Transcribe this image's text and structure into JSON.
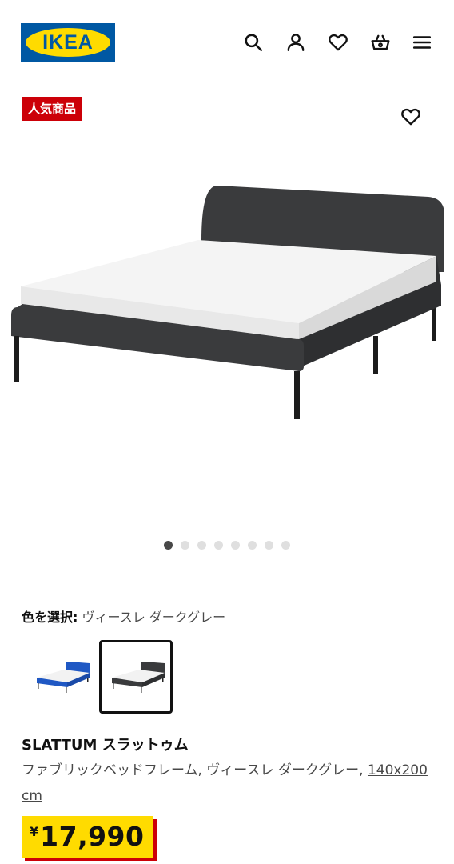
{
  "header": {
    "logo_text": "IKEA",
    "icons": [
      "search-icon",
      "user-icon",
      "heart-icon",
      "cart-icon",
      "menu-icon"
    ]
  },
  "badge": {
    "label": "人気商品"
  },
  "carousel": {
    "total": 8,
    "active": 1
  },
  "color_select": {
    "label": "色を選択:",
    "value": "ヴィースレ ダークグレー",
    "options": [
      {
        "color": "#1f58c4",
        "selected": false
      },
      {
        "color": "#3a3b3d",
        "selected": true
      }
    ]
  },
  "product": {
    "name": "SLATTUM スラットゥム",
    "description": "ファブリックベッドフレーム, ヴィースレ ダークグレー,",
    "size_link": "140x200 cm",
    "currency": "¥",
    "price": "17,990"
  },
  "colors": {
    "ikea_blue": "#0058a3",
    "ikea_yellow": "#ffdb00",
    "badge_red": "#cc0008",
    "frame_dark": "#3a3b3d"
  }
}
